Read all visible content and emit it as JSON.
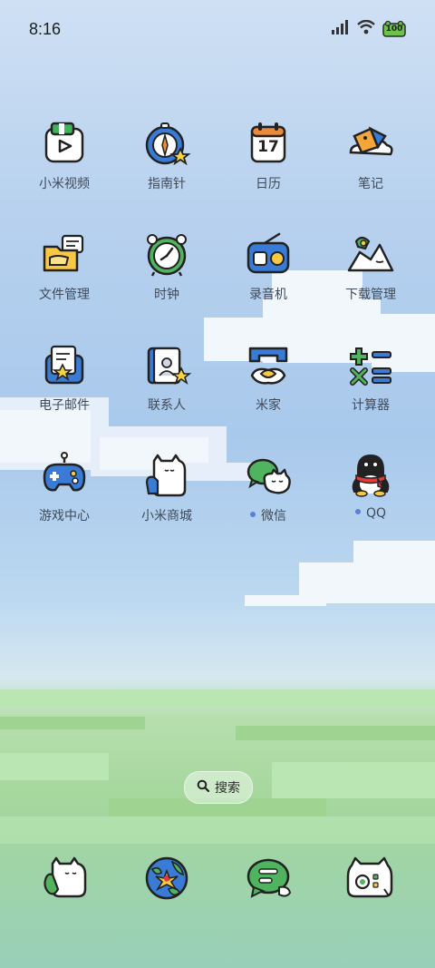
{
  "status": {
    "time": "8:16",
    "battery": "100"
  },
  "apps": [
    {
      "label": "小米视频",
      "icon": "video-player-icon",
      "badge": false
    },
    {
      "label": "指南针",
      "icon": "compass-icon",
      "badge": false
    },
    {
      "label": "日历",
      "icon": "calendar-icon",
      "calendar_day": "17",
      "badge": false
    },
    {
      "label": "笔记",
      "icon": "notes-icon",
      "badge": false
    },
    {
      "label": "文件管理",
      "icon": "folder-icon",
      "badge": false
    },
    {
      "label": "时钟",
      "icon": "clock-icon",
      "badge": false
    },
    {
      "label": "录音机",
      "icon": "radio-recorder-icon",
      "badge": false
    },
    {
      "label": "下载管理",
      "icon": "download-icon",
      "badge": false
    },
    {
      "label": "电子邮件",
      "icon": "mail-icon",
      "badge": false
    },
    {
      "label": "联系人",
      "icon": "contacts-book-icon",
      "badge": false
    },
    {
      "label": "米家",
      "icon": "mihome-icon",
      "badge": false
    },
    {
      "label": "计算器",
      "icon": "calculator-icon",
      "badge": false
    },
    {
      "label": "游戏中心",
      "icon": "gamepad-icon",
      "badge": false
    },
    {
      "label": "小米商城",
      "icon": "mi-store-cat-icon",
      "badge": false
    },
    {
      "label": "微信",
      "icon": "wechat-icon",
      "badge": true
    },
    {
      "label": "QQ",
      "icon": "qq-penguin-icon",
      "badge": true
    }
  ],
  "search": {
    "label": "搜索"
  },
  "dock": [
    {
      "icon": "phone-cat-icon"
    },
    {
      "icon": "browser-globe-icon"
    },
    {
      "icon": "messages-bubble-icon"
    },
    {
      "icon": "camera-cat-icon"
    }
  ],
  "colors": {
    "label_text": "#3f4a58",
    "badge_dot": "#5b7fd6"
  }
}
